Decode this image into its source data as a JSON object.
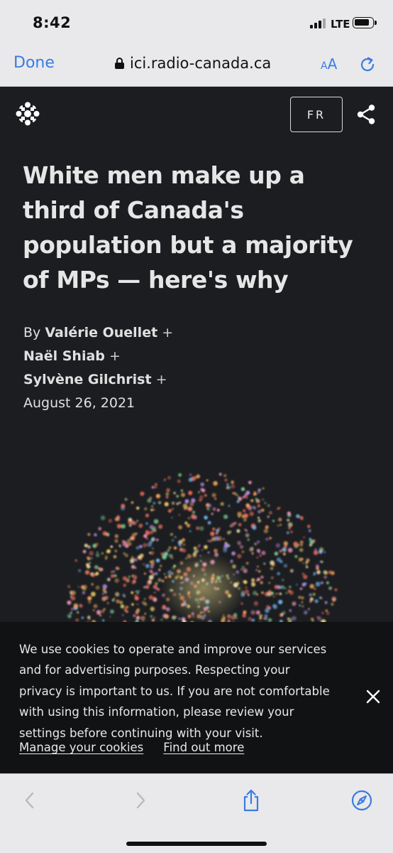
{
  "status_bar": {
    "time": "8:42",
    "network": "LTE",
    "signal_bars_active": 3,
    "signal_bars_total": 4
  },
  "browser": {
    "done_label": "Done",
    "url": "ici.radio-canada.ca",
    "text_size_label": "AA",
    "accent_color": "#3b7be3"
  },
  "article": {
    "language_button": "FR",
    "headline": "White men make up a third of Canada's population but a majority of MPs — here's why",
    "by_prefix": "By",
    "authors": [
      {
        "name": "Valérie Ouellet",
        "plus": "+"
      },
      {
        "name": "Naël Shiab",
        "plus": "+"
      },
      {
        "name": "Sylvène Gilchrist",
        "plus": "+"
      }
    ],
    "date": "August 26, 2021",
    "background_color": "#1b1d20"
  },
  "cookie_banner": {
    "message": "We use cookies to operate and improve our services and for advertising purposes. Respecting your privacy is important to us. If you are not comfortable with using this information, please review your settings before continuing with your visit.",
    "manage_link": "Manage your cookies",
    "more_link": "Find out more"
  },
  "toolbar": {
    "icons": [
      "back-icon",
      "forward-icon",
      "share-icon",
      "compass-icon"
    ]
  }
}
